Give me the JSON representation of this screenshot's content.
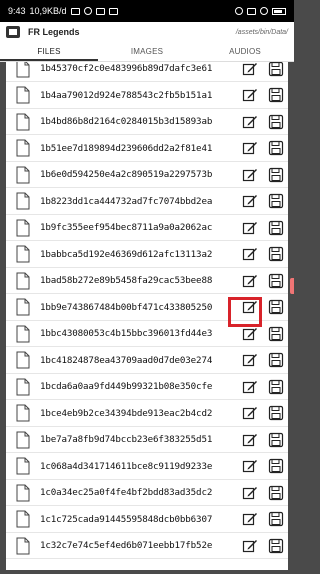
{
  "status_bar": {
    "time": "9:43",
    "network_speed": "10,9KB/d"
  },
  "app": {
    "title": "FR Legends",
    "path": "/assets/bin/Data/"
  },
  "tabs": [
    {
      "label": "FILES",
      "active": true
    },
    {
      "label": "IMAGES",
      "active": false
    },
    {
      "label": "AUDIOS",
      "active": false
    }
  ],
  "files": [
    "1b45370cf2c0e483996b89d7dafc3e61",
    "1b4aa79012d924e788543c2fb5b151a1",
    "1b4bd86b8d2164c0284015b3d15893ab",
    "1b51ee7d189894d239606dd2a2f81e41",
    "1b6e0d594250e4a2c890519a2297573b",
    "1b8223dd1ca444732ad7fc7074bbd2ea",
    "1b9fc355eef954bec8711a9a0a2062ac",
    "1babbca5d192e46369d612afc13113a2",
    "1bad58b272e89b5458fa29cac53bee88",
    "1bb9e743867484b00bf471c433805250",
    "1bbc43080053c4b15bbc396013fd44e3",
    "1bc41824878ea43709aad0d7de03e274",
    "1bcda6a0aa9fd449b99321b08e350cfe",
    "1bce4eb9b2ce34394bde913eac2b4cd2",
    "1be7a7a8fb9d74bccb23e6f383255d51",
    "1c068a4d341714611bce8c9119d9233e",
    "1c0a34ec25a0f4fe4bf2bdd83ad35dc2",
    "1c1c725cada91445595848dcb0bb6307",
    "1c32c7e74c5ef4ed6b071eebb17fb52e"
  ],
  "highlighted_file": "1bb9e743867484b00bf471c433805250",
  "colors": {
    "highlight": "#d8232a",
    "status_bar": "#000000",
    "background": "#ffffff"
  },
  "icons": {
    "file": "file-icon",
    "edit": "edit-icon",
    "save": "save-icon"
  }
}
